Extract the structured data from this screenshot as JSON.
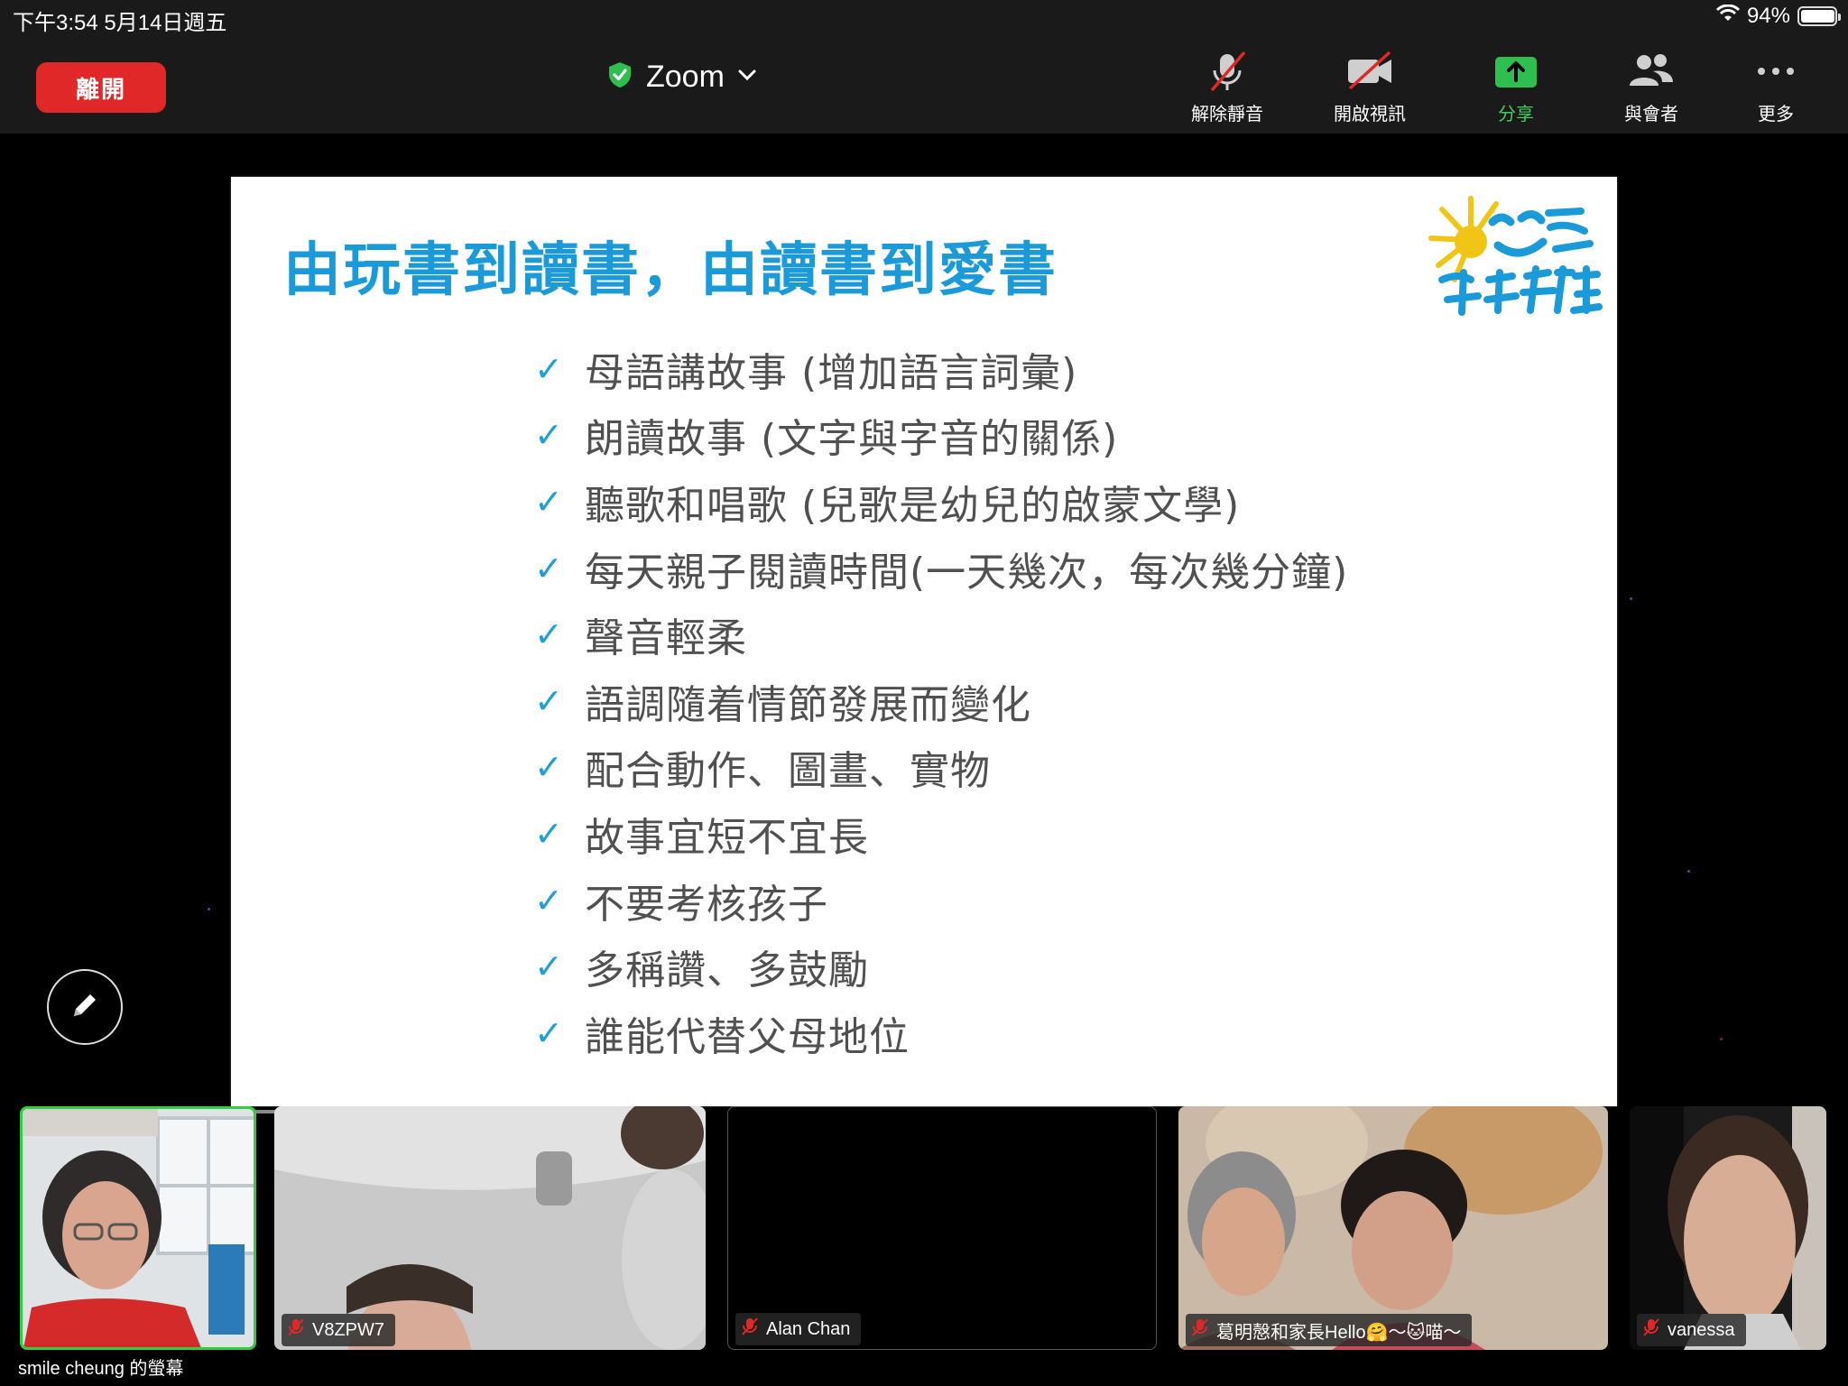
{
  "status_bar": {
    "time": "下午3:54   5月14日週五",
    "battery": "94%"
  },
  "toolbar": {
    "leave_label": "離開",
    "meeting_name": "Zoom",
    "tools": {
      "unmute": "解除靜音",
      "start_video": "開啟視訊",
      "share": "分享",
      "participants": "與會者",
      "more": "更多"
    }
  },
  "slide": {
    "title": "由玩書到讀書，由讀書到愛書",
    "logo_text": "笑容生活教室",
    "bullets": [
      "母語講故事 (增加語言詞彙)",
      "朗讀故事 (文字與字音的關係)",
      "聽歌和唱歌 (兒歌是幼兒的啟蒙文學)",
      "每天親子閱讀時間(一天幾次，每次幾分鐘)",
      "聲音輕柔",
      "語調隨着情節發展而變化",
      "配合動作、圖畫、實物",
      "故事宜短不宜長",
      "不要考核孩子",
      "多稱讚、多鼓勵",
      "誰能代替父母地位"
    ]
  },
  "participants": [
    {
      "name": "",
      "caption": "smile cheung 的螢幕"
    },
    {
      "name": "V8ZPW7"
    },
    {
      "name": "Alan Chan"
    },
    {
      "name": "葛明慤和家長Hello🤗～🐱喵～"
    },
    {
      "name": "vanessa"
    }
  ],
  "colors": {
    "leave": "#e02828",
    "share": "#3fcf60",
    "title": "#1a9ad9",
    "active_speaker": "#2fcf3f"
  }
}
